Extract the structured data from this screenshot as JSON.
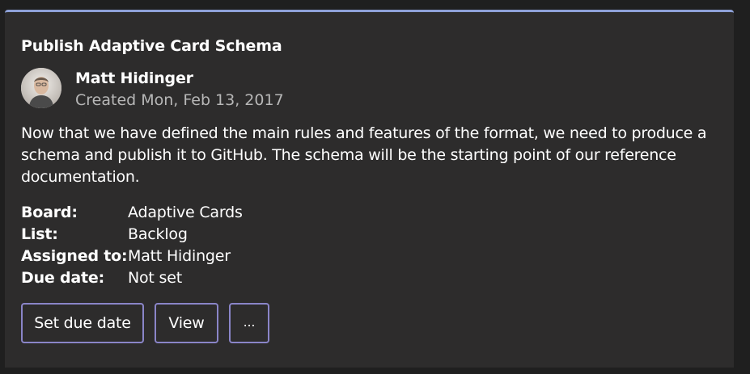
{
  "card": {
    "title": "Publish Adaptive Card Schema",
    "author": {
      "name": "Matt Hidinger",
      "created": "Created Mon, Feb 13, 2017",
      "avatar_icon": "user-avatar-icon"
    },
    "description": "Now that we have defined the main rules and features of the format, we need to produce a schema and publish it to GitHub. The schema will be the starting point of our reference documentation.",
    "facts": [
      {
        "label": "Board:",
        "value": "Adaptive Cards"
      },
      {
        "label": "List:",
        "value": "Backlog"
      },
      {
        "label": "Assigned to:",
        "value": "Matt Hidinger"
      },
      {
        "label": "Due date:",
        "value": "Not set"
      }
    ],
    "actions": {
      "set_due_date": "Set due date",
      "view": "View",
      "more": "..."
    }
  },
  "colors": {
    "background": "#2d2c2c",
    "accent_top_border": "#8ea1d8",
    "button_border": "#8a85c8",
    "subtle_text": "#b7b7b7"
  }
}
